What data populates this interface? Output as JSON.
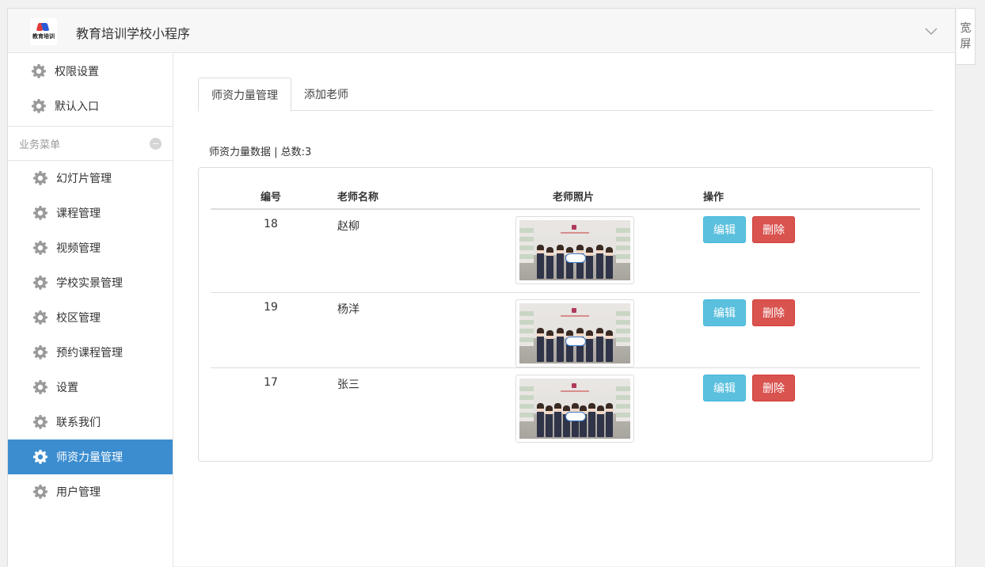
{
  "header": {
    "logo_text": "教育培训",
    "app_title": "教育培训学校小程序",
    "wide_label_1": "宽",
    "wide_label_2": "屏"
  },
  "sidebar": {
    "top_items": [
      {
        "label": "权限设置"
      },
      {
        "label": "默认入口"
      }
    ],
    "section_label": "业务菜单",
    "items": [
      {
        "label": "幻灯片管理"
      },
      {
        "label": "课程管理"
      },
      {
        "label": "视频管理"
      },
      {
        "label": "学校实景管理"
      },
      {
        "label": "校区管理"
      },
      {
        "label": "预约课程管理"
      },
      {
        "label": "设置"
      },
      {
        "label": "联系我们"
      },
      {
        "label": "师资力量管理",
        "active": true
      },
      {
        "label": "用户管理"
      }
    ]
  },
  "tabs": [
    {
      "label": "师资力量管理",
      "active": true
    },
    {
      "label": "添加老师"
    }
  ],
  "data_title": "师资力量数据 | 总数:3",
  "table": {
    "headers": [
      "编号",
      "老师名称",
      "老师照片",
      "操作"
    ],
    "rows": [
      {
        "id": "18",
        "name": "赵柳"
      },
      {
        "id": "19",
        "name": "杨洋"
      },
      {
        "id": "17",
        "name": "张三"
      }
    ],
    "edit_label": "编辑",
    "delete_label": "删除"
  },
  "colors": {
    "active_menu": "#3c8dd0",
    "edit_button": "#5bc0de",
    "delete_button": "#d9534f"
  }
}
